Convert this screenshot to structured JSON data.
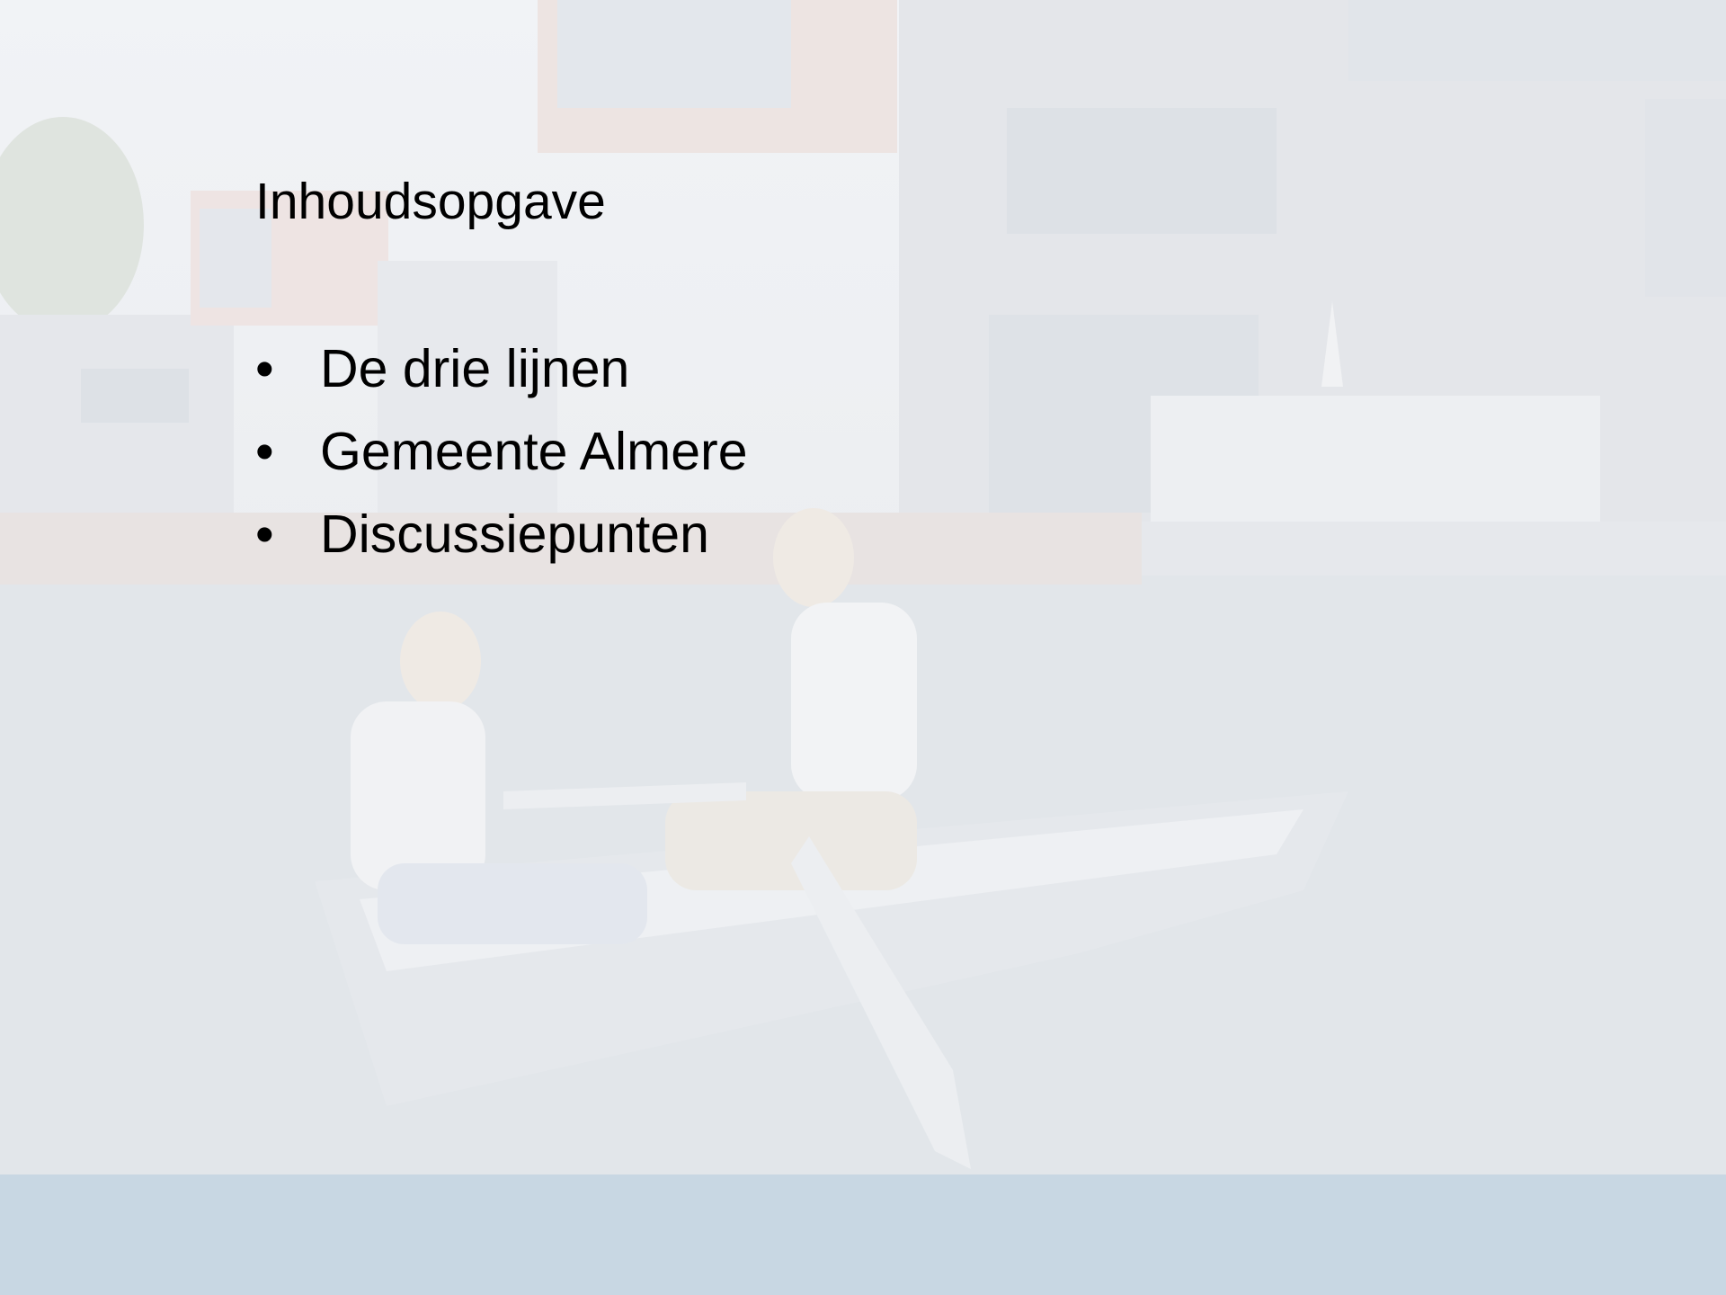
{
  "slide": {
    "title": "Inhoudsopgave",
    "bullet_symbol": "•",
    "items": [
      {
        "label": "De drie lijnen"
      },
      {
        "label": "Gemeente Almere"
      },
      {
        "label": "Discussiepunten"
      }
    ]
  },
  "background": {
    "image_description_icon": "faded-photo-icon",
    "band_color": "#c6d6e2",
    "wash_color": "#eceef1"
  }
}
